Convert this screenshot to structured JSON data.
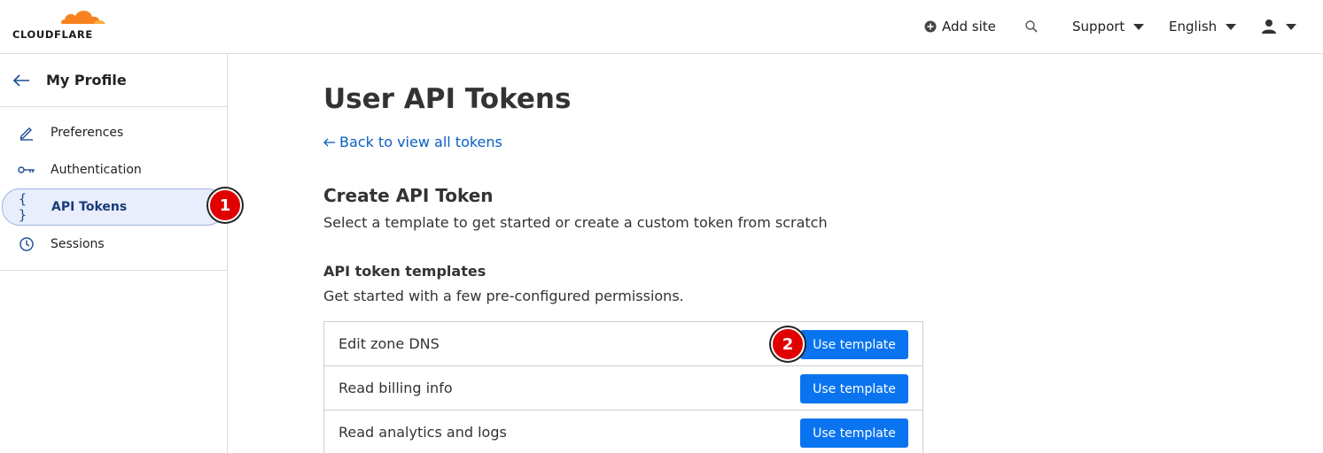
{
  "header": {
    "logo_text": "CLOUDFLARE",
    "add_site": "Add site",
    "support": "Support",
    "language": "English"
  },
  "sidebar": {
    "title": "My Profile",
    "items": [
      {
        "label": "Preferences",
        "icon": "pencil-icon"
      },
      {
        "label": "Authentication",
        "icon": "key-icon"
      },
      {
        "label": "API Tokens",
        "icon": "braces-icon",
        "active": true
      },
      {
        "label": "Sessions",
        "icon": "clock-icon"
      }
    ]
  },
  "main": {
    "title": "User API Tokens",
    "back_link": "Back to view all tokens",
    "create_title": "Create API Token",
    "create_subtitle": "Select a template to get started or create a custom token from scratch",
    "templates_title": "API token templates",
    "templates_subtitle": "Get started with a few pre-configured permissions.",
    "templates": [
      {
        "name": "Edit zone DNS",
        "button": "Use template"
      },
      {
        "name": "Read billing info",
        "button": "Use template"
      },
      {
        "name": "Read analytics and logs",
        "button": "Use template"
      }
    ]
  },
  "annotations": {
    "step1": "1",
    "step2": "2"
  },
  "colors": {
    "accent": "#0a74f0",
    "brand_orange": "#f6821f",
    "badge_red": "#e10000"
  }
}
